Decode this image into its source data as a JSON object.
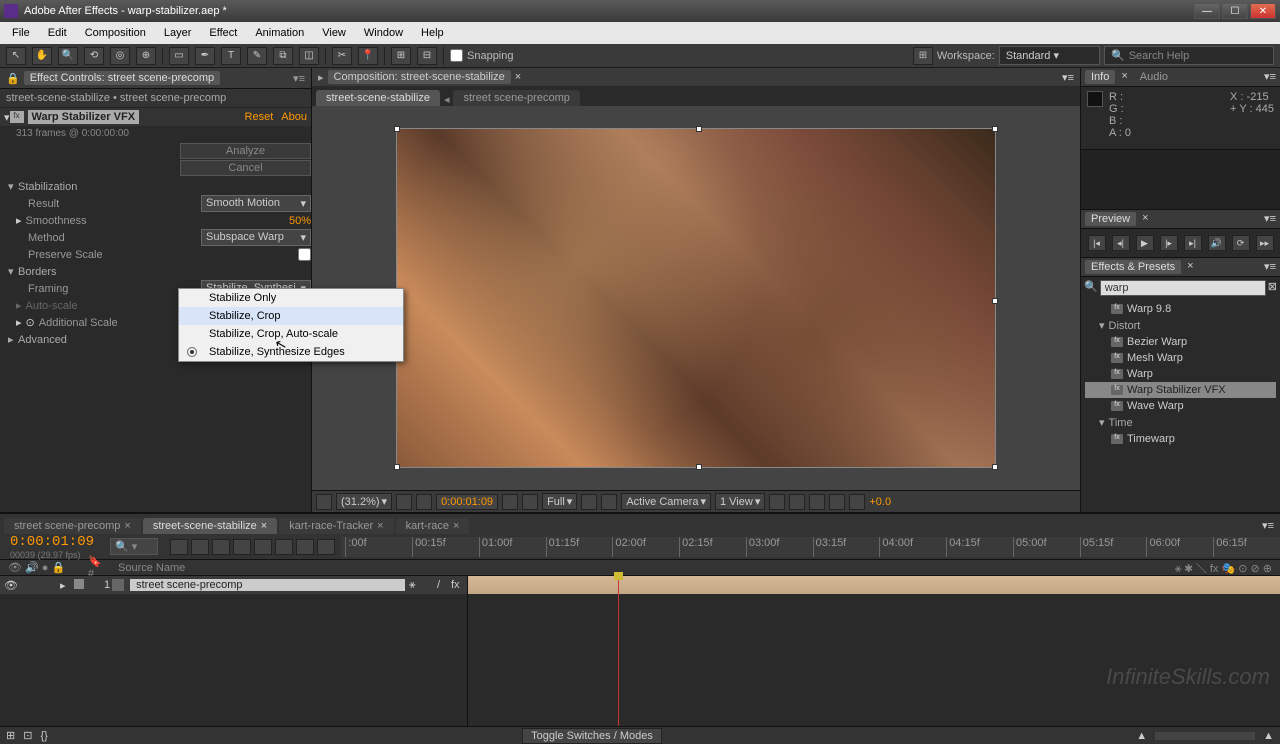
{
  "titlebar": {
    "title": "Adobe After Effects - warp-stabilizer.aep *"
  },
  "menu": {
    "items": [
      "File",
      "Edit",
      "Composition",
      "Layer",
      "Effect",
      "Animation",
      "View",
      "Window",
      "Help"
    ]
  },
  "toolbar": {
    "snapping": "Snapping",
    "workspace_label": "Workspace:",
    "workspace_value": "Standard",
    "search_placeholder": "Search Help"
  },
  "effect_controls": {
    "tab": "Effect Controls: street scene-precomp",
    "breadcrumb": "street-scene-stabilize • street scene-precomp",
    "effect_name": "Warp Stabilizer VFX",
    "reset": "Reset",
    "about": "Abou",
    "frames_info": "313 frames @ 0:00:00:00",
    "analyze": "Analyze",
    "cancel": "Cancel",
    "sections": {
      "stabilization": "Stabilization",
      "result": "Result",
      "result_value": "Smooth Motion",
      "smoothness": "Smoothness",
      "smoothness_value": "50%",
      "method": "Method",
      "method_value": "Subspace Warp",
      "preserve_scale": "Preserve Scale",
      "borders": "Borders",
      "framing": "Framing",
      "framing_value": "Stabilize, Synthesi",
      "auto_scale": "Auto-scale",
      "additional_scale": "Additional Scale",
      "advanced": "Advanced"
    }
  },
  "framing_dropdown": {
    "items": [
      "Stabilize Only",
      "Stabilize, Crop",
      "Stabilize, Crop, Auto-scale",
      "Stabilize, Synthesize Edges"
    ],
    "selected_index": 3,
    "highlighted_index": 1
  },
  "composition": {
    "header": "Composition: street-scene-stabilize",
    "breadcrumb1": "street-scene-stabilize",
    "breadcrumb2": "street scene-precomp",
    "zoom": "(31.2%)",
    "timecode": "0:00:01:09",
    "resolution": "Full",
    "camera": "Active Camera",
    "view": "1 View",
    "exposure": "+0.0"
  },
  "info": {
    "tab_info": "Info",
    "tab_audio": "Audio",
    "r": "R :",
    "g": "G :",
    "b": "B :",
    "a": "A : 0",
    "x": "X : -215",
    "y": "Y :  445"
  },
  "preview": {
    "title": "Preview"
  },
  "effects_presets": {
    "title": "Effects & Presets",
    "search": "warp",
    "items": [
      {
        "label": "Warp 9.8",
        "cat": false
      },
      {
        "label": "Distort",
        "cat": true
      },
      {
        "label": "Bezier Warp",
        "cat": false
      },
      {
        "label": "Mesh Warp",
        "cat": false
      },
      {
        "label": "Warp",
        "cat": false
      },
      {
        "label": "Warp Stabilizer VFX",
        "cat": false,
        "selected": true
      },
      {
        "label": "Wave Warp",
        "cat": false
      },
      {
        "label": "Time",
        "cat": true
      },
      {
        "label": "Timewarp",
        "cat": false
      }
    ]
  },
  "timeline": {
    "tabs": [
      "street scene-precomp",
      "street-scene-stabilize",
      "kart-race-Tracker",
      "kart-race"
    ],
    "active_tab": 1,
    "current_time": "0:00:01:09",
    "frame_info": "00039 (29.97 fps)",
    "source_name_col": "Source Name",
    "layer_num": "1",
    "layer_name": "street scene-precomp",
    "ruler": [
      ":00f",
      "00:15f",
      "01:00f",
      "01:15f",
      "02:00f",
      "02:15f",
      "03:00f",
      "03:15f",
      "04:00f",
      "04:15f",
      "05:00f",
      "05:15f",
      "06:00f",
      "06:15f"
    ],
    "toggle": "Toggle Switches / Modes"
  },
  "watermark": "InfiniteSkills.com"
}
